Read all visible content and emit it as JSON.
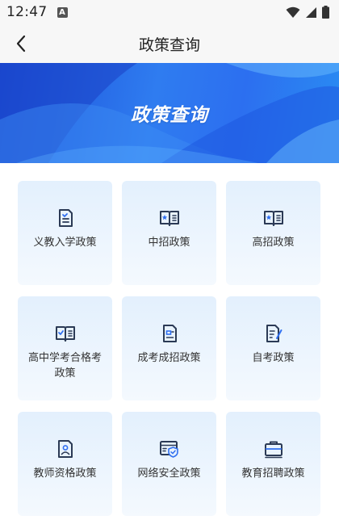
{
  "status_bar": {
    "time": "12:47",
    "notification_icon": "A"
  },
  "nav": {
    "title": "政策查询",
    "back_icon": "chevron-left-icon"
  },
  "banner": {
    "title": "政策查询"
  },
  "colors": {
    "accent": "#2f6ff0",
    "icon": "#2b3a55",
    "card_bg_top": "#e3f0fd"
  },
  "cards": [
    {
      "label": "义教入学政策",
      "icon": "document-check-icon"
    },
    {
      "label": "中招政策",
      "icon": "star-book-icon"
    },
    {
      "label": "高招政策",
      "icon": "star-book-icon"
    },
    {
      "label": "高中学考合格考政策",
      "icon": "check-book-icon"
    },
    {
      "label": "成考成招政策",
      "icon": "id-document-icon"
    },
    {
      "label": "自考政策",
      "icon": "document-edit-icon"
    },
    {
      "label": "教师资格政策",
      "icon": "teacher-certificate-icon"
    },
    {
      "label": "网络安全政策",
      "icon": "shield-browser-icon"
    },
    {
      "label": "教育招聘政策",
      "icon": "briefcase-icon"
    }
  ]
}
